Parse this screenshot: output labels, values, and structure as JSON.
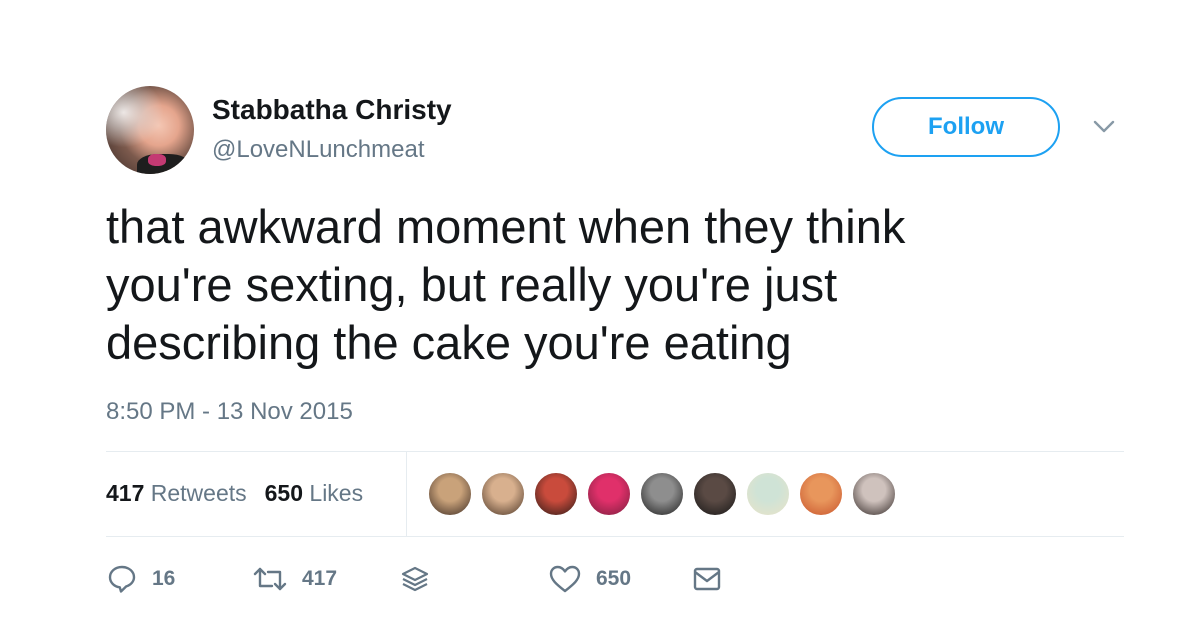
{
  "user": {
    "display_name": "Stabbatha Christy",
    "handle": "@LoveNLunchmeat"
  },
  "follow_button": {
    "label": "Follow"
  },
  "tweet": {
    "lines": [
      "that awkward moment when they think",
      "you're sexting, but really you're just",
      "describing the cake you're eating"
    ],
    "timestamp": "8:50 PM - 13 Nov 2015"
  },
  "stats": {
    "retweets_count": "417",
    "retweets_label": "Retweets",
    "likes_count": "650",
    "likes_label": "Likes"
  },
  "likers": [
    {
      "color_a": "#c9a27a",
      "color_b": "#3b2a22"
    },
    {
      "color_a": "#d8b08e",
      "color_b": "#4a3526"
    },
    {
      "color_a": "#c94b3c",
      "color_b": "#2a1a16"
    },
    {
      "color_a": "#e0306a",
      "color_b": "#7a1f3d"
    },
    {
      "color_a": "#8e8e8e",
      "color_b": "#1c1c1c"
    },
    {
      "color_a": "#5a4a44",
      "color_b": "#161616"
    },
    {
      "color_a": "#cfe3d6",
      "color_b": "#e9e3c8"
    },
    {
      "color_a": "#e8965c",
      "color_b": "#c8542c"
    },
    {
      "color_a": "#cfc2bd",
      "color_b": "#2f2624"
    }
  ],
  "actions": {
    "reply_count": "16",
    "retweet_count": "417",
    "like_count": "650"
  },
  "icons": {
    "reply": "reply-icon",
    "retweet": "retweet-icon",
    "stack": "layers-icon",
    "like": "heart-icon",
    "message": "envelope-icon",
    "caret": "chevron-down-icon"
  },
  "colors": {
    "accent": "#1da1f2",
    "secondary_text": "#657786",
    "primary_text": "#14171a",
    "divider": "#e6ecf0"
  }
}
